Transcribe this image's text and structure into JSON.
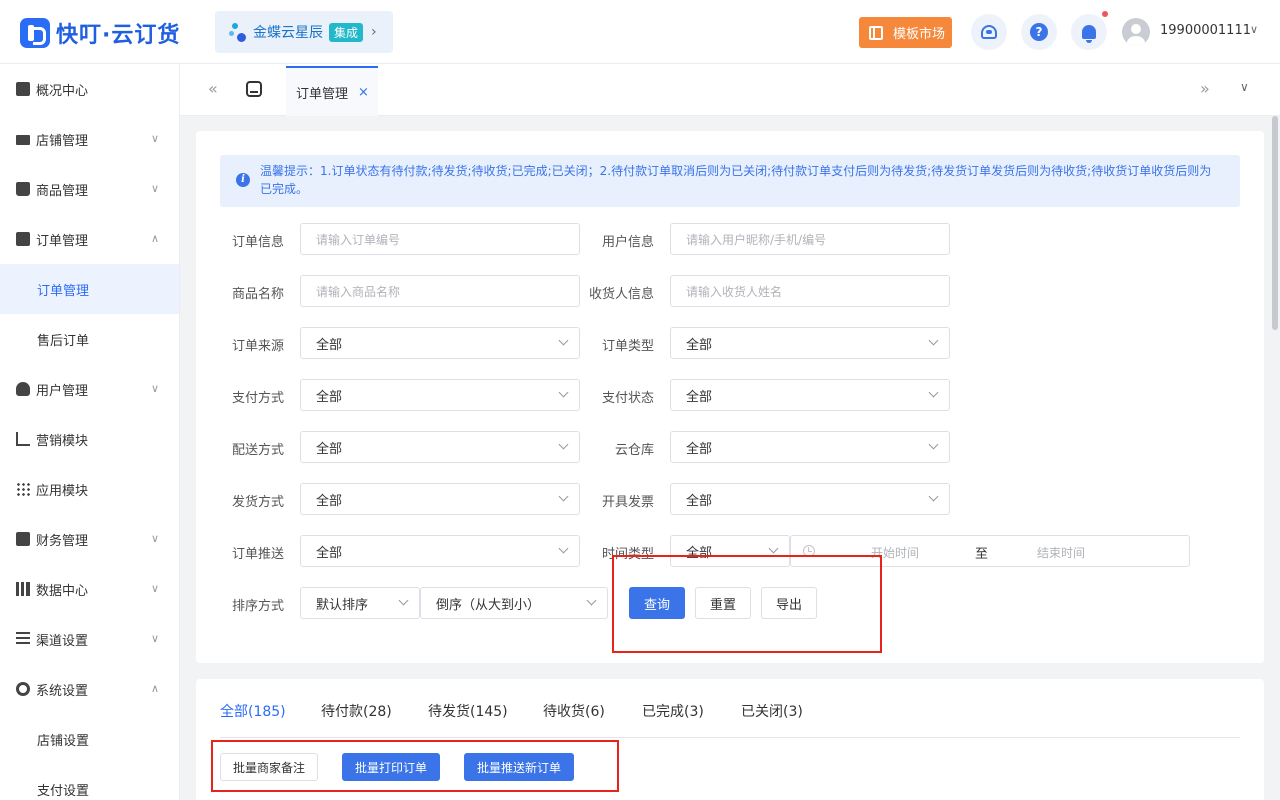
{
  "header": {
    "logo_text": "快叮·云订货",
    "brand": {
      "name": "金蝶云星辰",
      "tag": "集成",
      "chevron": "›"
    },
    "template_market": "模板市场",
    "user": {
      "phone": "19900001111",
      "chevron": "∨"
    },
    "help_glyph": "?"
  },
  "sidebar": {
    "items": [
      {
        "label": "概况中心",
        "icon": "lock-icon"
      },
      {
        "label": "店铺管理",
        "icon": "shop-icon",
        "chevron": "∨"
      },
      {
        "label": "商品管理",
        "icon": "bag-icon",
        "chevron": "∨"
      },
      {
        "label": "订单管理",
        "icon": "clipboard-icon",
        "chevron": "∧"
      },
      {
        "label": "订单管理",
        "sub": true,
        "active": true
      },
      {
        "label": "售后订单",
        "sub": true
      },
      {
        "label": "用户管理",
        "icon": "user-icon",
        "chevron": "∨"
      },
      {
        "label": "营销模块",
        "icon": "trend-icon"
      },
      {
        "label": "应用模块",
        "icon": "grid-icon"
      },
      {
        "label": "财务管理",
        "icon": "wallet-icon",
        "chevron": "∨"
      },
      {
        "label": "数据中心",
        "icon": "bar-chart-icon",
        "chevron": "∨"
      },
      {
        "label": "渠道设置",
        "icon": "list-icon",
        "chevron": "∨"
      },
      {
        "label": "系统设置",
        "icon": "gear-icon",
        "chevron": "∧"
      },
      {
        "label": "店铺设置",
        "sub": true
      },
      {
        "label": "支付设置",
        "sub": true
      }
    ]
  },
  "tabs": {
    "prev": "«",
    "next": "»",
    "down": "∨",
    "active_tab": "订单管理",
    "close": "×"
  },
  "notice": "温馨提示：1.订单状态有待付款;待发货;待收货;已完成;已关闭；2.待付款订单取消后则为已关闭;待付款订单支付后则为待发货;待发货订单发货后则为待收货;待收货订单收货后则为已完成。",
  "notice_icon": "i",
  "filters": {
    "order_info": {
      "label": "订单信息",
      "placeholder": "请输入订单编号"
    },
    "user_info": {
      "label": "用户信息",
      "placeholder": "请输入用户昵称/手机/编号"
    },
    "product_name": {
      "label": "商品名称",
      "placeholder": "请输入商品名称"
    },
    "receiver_info": {
      "label": "收货人信息",
      "placeholder": "请输入收货人姓名"
    },
    "order_source": {
      "label": "订单来源",
      "value": "全部"
    },
    "order_type": {
      "label": "订单类型",
      "value": "全部"
    },
    "pay_method": {
      "label": "支付方式",
      "value": "全部"
    },
    "pay_status": {
      "label": "支付状态",
      "value": "全部"
    },
    "delivery_method": {
      "label": "配送方式",
      "value": "全部"
    },
    "cloud_warehouse": {
      "label": "云仓库",
      "value": "全部"
    },
    "ship_method": {
      "label": "发货方式",
      "value": "全部"
    },
    "invoice": {
      "label": "开具发票",
      "value": "全部"
    },
    "order_push": {
      "label": "订单推送",
      "value": "全部"
    },
    "time_type": {
      "label": "时间类型",
      "value": "全部",
      "start": "开始时间",
      "sep": "至",
      "end": "结束时间"
    },
    "sort": {
      "label": "排序方式",
      "value": "默认排序",
      "order": "倒序（从大到小）"
    }
  },
  "actions": {
    "query": "查询",
    "reset": "重置",
    "export": "导出"
  },
  "status_tabs": [
    {
      "label": "全部(185)",
      "active": true
    },
    {
      "label": "待付款(28)"
    },
    {
      "label": "待发货(145)"
    },
    {
      "label": "待收货(6)"
    },
    {
      "label": "已完成(3)"
    },
    {
      "label": "已关闭(3)"
    }
  ],
  "batch": {
    "remark": "批量商家备注",
    "print": "批量打印订单",
    "push": "批量推送新订单"
  },
  "colors": {
    "primary": "#3a74e8",
    "highlight": "#e8231b",
    "template_button": "#f5883a"
  }
}
